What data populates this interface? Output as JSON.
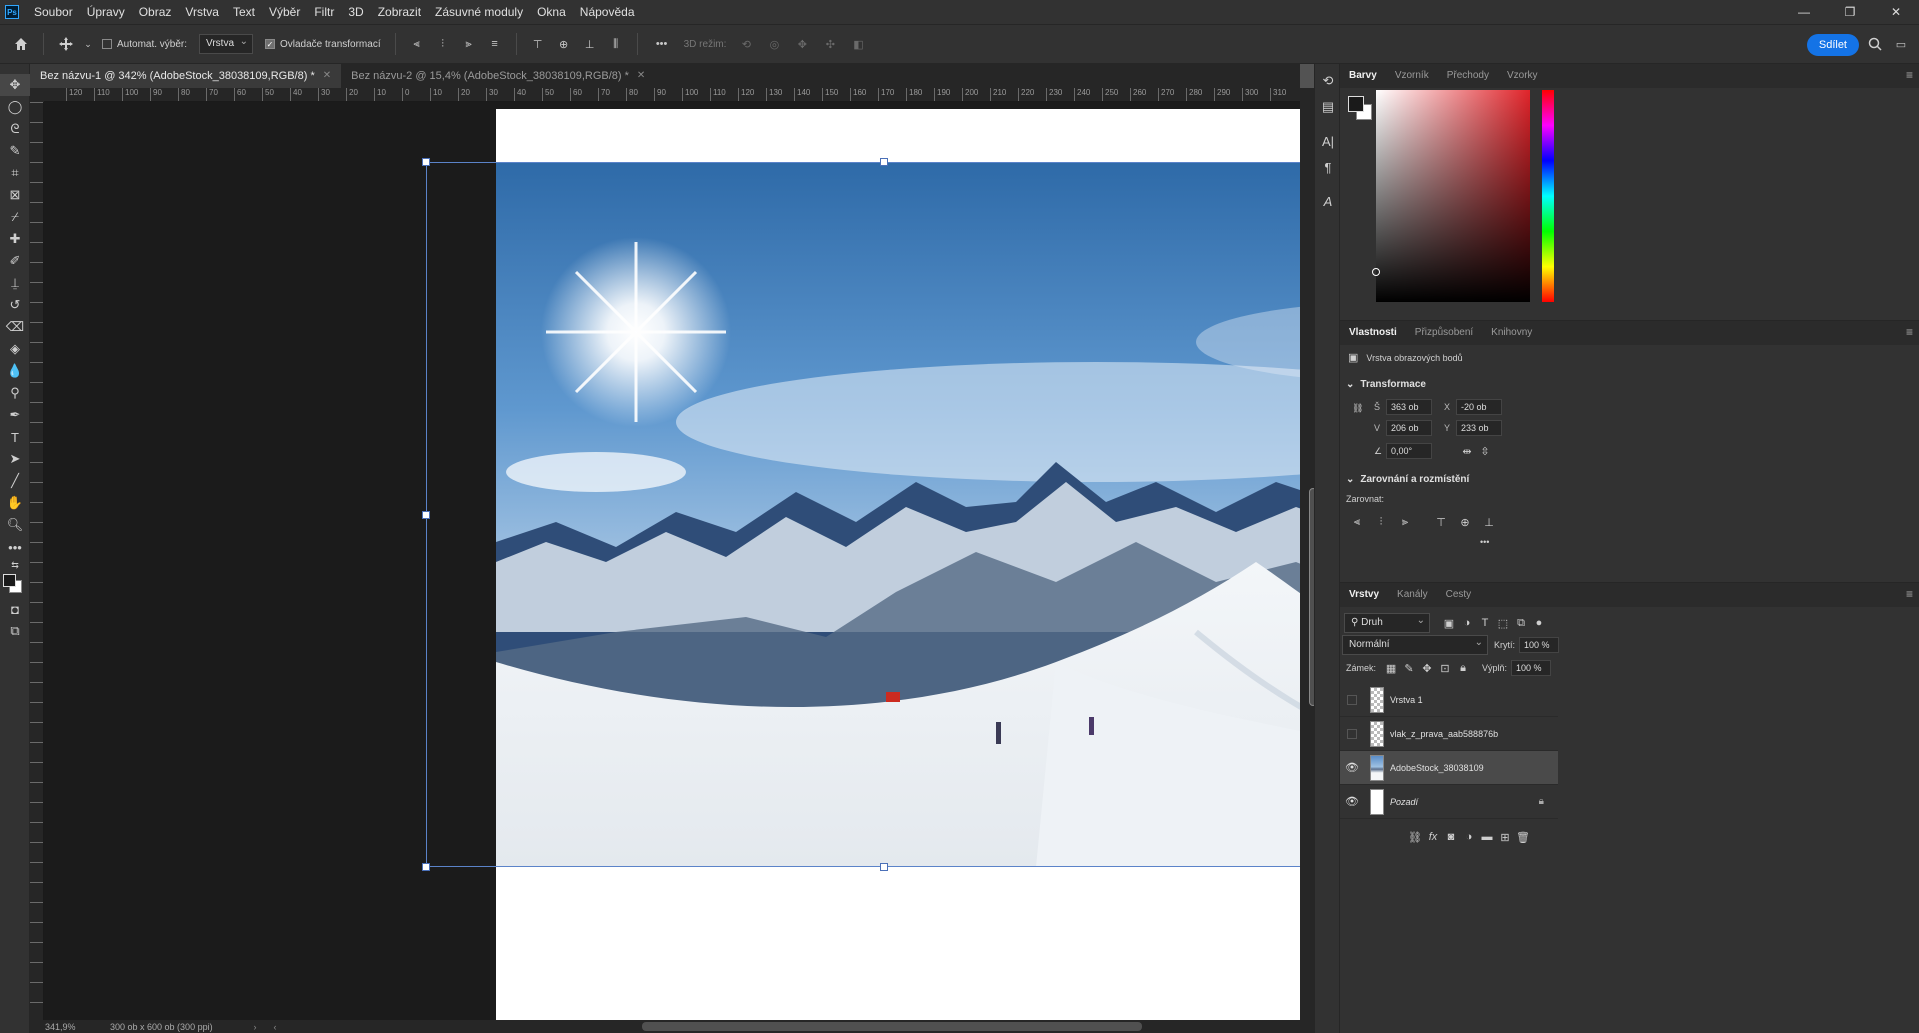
{
  "app": {
    "logo_text": "Ps",
    "menu": [
      "Soubor",
      "Úpravy",
      "Obraz",
      "Vrstva",
      "Text",
      "Výběr",
      "Filtr",
      "3D",
      "Zobrazit",
      "Zásuvné moduly",
      "Okna",
      "Nápověda"
    ],
    "window_controls": [
      "—",
      "❐",
      "✕"
    ]
  },
  "options_bar": {
    "auto_select_label": "Automat. výběr:",
    "auto_select_checked": false,
    "auto_select_target": "Vrstva",
    "transform_controls_label": "Ovladače transformací",
    "transform_controls_checked": true,
    "mode_3d_label": "3D režim:",
    "more_label": "•••",
    "share_label": "Sdílet"
  },
  "doc_tabs": [
    {
      "label": "Bez názvu-1 @ 342% (AdobeStock_38038109,RGB/8) *",
      "active": true
    },
    {
      "label": "Bez názvu-2 @ 15,4% (AdobeStock_38038109,RGB/8) *",
      "active": false
    }
  ],
  "ruler": {
    "h_labels": [
      "120",
      "110",
      "100",
      "90",
      "80",
      "70",
      "60",
      "50",
      "40",
      "30",
      "20",
      "10",
      "0",
      "10",
      "20",
      "30",
      "40",
      "50",
      "60",
      "70",
      "80",
      "90",
      "100",
      "110",
      "120",
      "130",
      "140",
      "150",
      "160",
      "170",
      "180",
      "190",
      "200",
      "210",
      "220",
      "230",
      "240",
      "250",
      "260",
      "270",
      "280",
      "290",
      "300",
      "310"
    ]
  },
  "status": {
    "zoom": "341,9%",
    "doc_info": "300 ob x 600 ob (300 ppi)"
  },
  "color_panel": {
    "tabs": [
      "Barvy",
      "Vzorník",
      "Přechody",
      "Vzorky"
    ],
    "active_tab": "Barvy",
    "hue_color": "#e0242a"
  },
  "properties_panel": {
    "tabs": [
      "Vlastnosti",
      "Přizpůsobení",
      "Knihovny"
    ],
    "active_tab": "Vlastnosti",
    "layer_kind": "Vrstva obrazových bodů",
    "transform_title": "Transformace",
    "w_label": "Š",
    "w_value": "363 ob",
    "h_label": "V",
    "h_value": "206 ob",
    "x_label": "X",
    "x_value": "-20 ob",
    "y_label": "Y",
    "y_value": "233 ob",
    "angle_value": "0,00°",
    "align_title": "Zarovnání a rozmístění",
    "align_label": "Zarovnat:",
    "more_label": "•••"
  },
  "layers_panel": {
    "tabs": [
      "Vrstvy",
      "Kanály",
      "Cesty"
    ],
    "active_tab": "Vrstvy",
    "filter_label": "Druh",
    "blend_mode": "Normální",
    "opacity_label": "Krytí:",
    "opacity_value": "100 %",
    "lock_label": "Zámek:",
    "fill_label": "Výplň:",
    "fill_value": "100 %",
    "layers": [
      {
        "name": "Vrstva 1",
        "visible": false,
        "thumb": "checker",
        "selected": false,
        "italic": false
      },
      {
        "name": "vlak_z_prava_aab588876b",
        "visible": false,
        "thumb": "checker",
        "selected": false,
        "italic": false
      },
      {
        "name": "AdobeStock_38038109",
        "visible": true,
        "thumb": "photo",
        "selected": true,
        "italic": false
      },
      {
        "name": "Pozadí",
        "visible": true,
        "thumb": "white",
        "selected": false,
        "italic": true,
        "locked": true
      }
    ]
  }
}
